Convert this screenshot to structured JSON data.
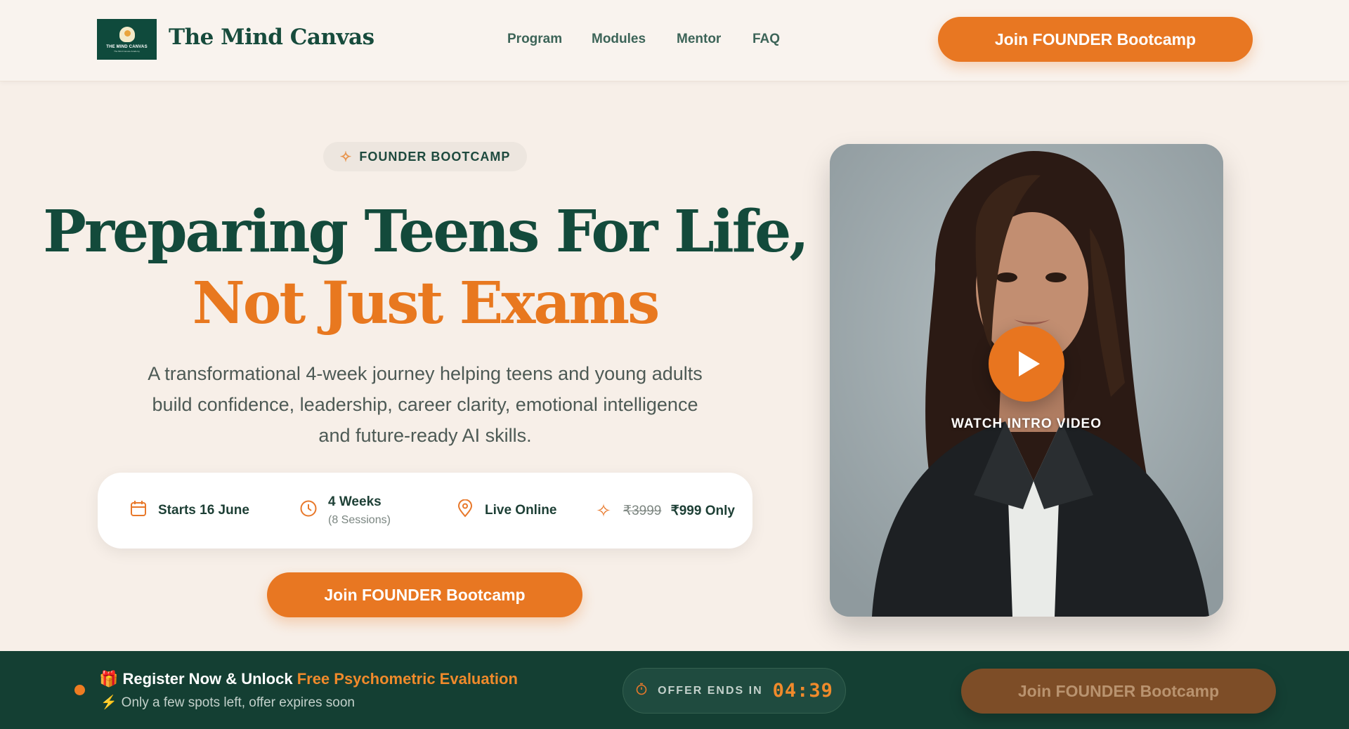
{
  "header": {
    "logo": {
      "text": "THE MIND CANVAS",
      "sub": "The Mind Canvas Academy"
    },
    "brand": "The Mind Canvas",
    "nav": [
      "Program",
      "Modules",
      "Mentor",
      "FAQ"
    ],
    "cta_label": "Join FOUNDER Bootcamp"
  },
  "hero": {
    "badge": "FOUNDER BOOTCAMP",
    "title_line1": "Preparing Teens For Life,",
    "title_line2": "Not Just Exams",
    "subtitle": "A transformational 4-week journey helping teens and young adults build confidence, leadership, career clarity, emotional intelligence and future-ready AI skills.",
    "info": {
      "start": "Starts 16 June",
      "duration": "4 Weeks",
      "duration_sub": "(8 Sessions)",
      "mode": "Live Online",
      "old_price": "₹3999",
      "price": "₹999 Only"
    },
    "cta_label": "Join FOUNDER Bootcamp"
  },
  "video": {
    "label": "WATCH INTRO VIDEO"
  },
  "bottom_bar": {
    "register_prefix": "Register Now & Unlock ",
    "register_highlight": "Free Psychometric Evaluation",
    "spots": "Only a few spots left, offer expires soon",
    "timer_label": "OFFER ENDS IN",
    "timer_value": "04:39",
    "cta_label": "Join FOUNDER Bootcamp"
  },
  "colors": {
    "accent": "#e87722",
    "primary": "#134a3b",
    "background": "#f7efe8",
    "bar": "#143f33"
  }
}
